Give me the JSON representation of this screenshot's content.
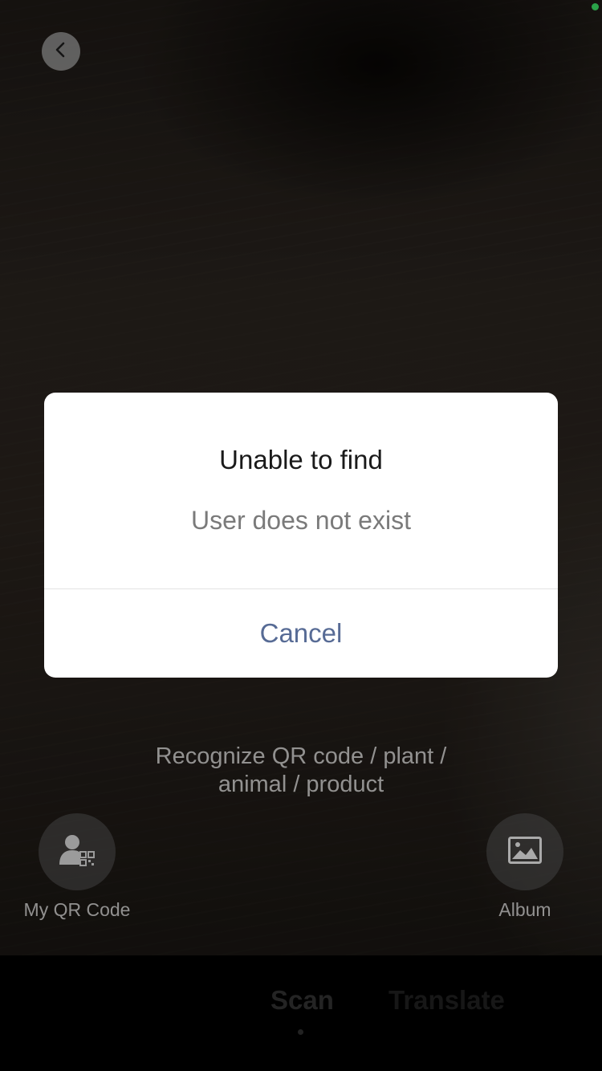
{
  "colors": {
    "status_indicator": "#34c759",
    "cancel_link": "#576b95"
  },
  "dialog": {
    "title": "Unable to find",
    "message": "User does not exist",
    "cancel_label": "Cancel"
  },
  "scanner": {
    "hint_lines": [
      "Recognize QR code / plant /",
      "animal / product"
    ],
    "my_qr_code_label": "My QR Code",
    "album_label": "Album",
    "icons": {
      "back": "chevron-left-icon",
      "my_qr_code": "user-qr-icon",
      "album": "image-icon"
    }
  },
  "tabs": [
    {
      "label": "Scan",
      "active": true
    },
    {
      "label": "Translate",
      "active": false
    }
  ]
}
